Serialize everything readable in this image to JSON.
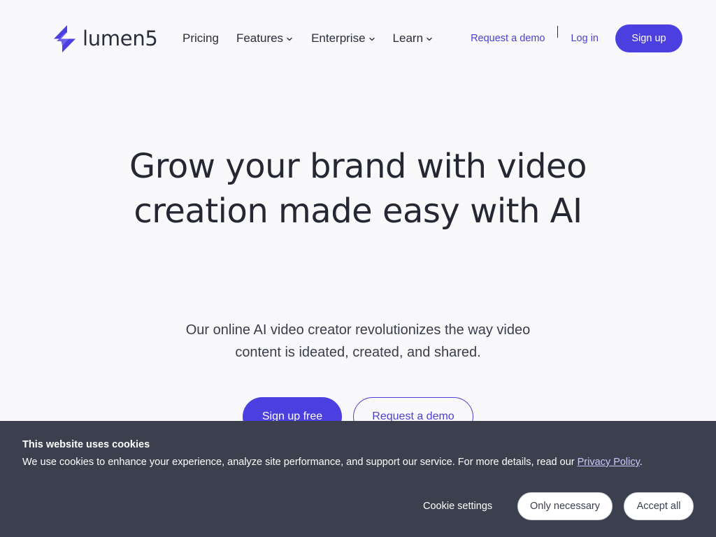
{
  "brand": {
    "name": "lumen5",
    "accent_color": "#4b3fe0"
  },
  "nav": {
    "items": [
      {
        "label": "Pricing",
        "has_dropdown": false
      },
      {
        "label": "Features",
        "has_dropdown": true
      },
      {
        "label": "Enterprise",
        "has_dropdown": true
      },
      {
        "label": "Learn",
        "has_dropdown": true
      }
    ]
  },
  "header_actions": {
    "request_demo": "Request a demo",
    "login": "Log in",
    "signup": "Sign up"
  },
  "hero": {
    "title": "Grow your brand with video creation made easy with AI",
    "subtitle": "Our online AI video creator revolutionizes the way video content is ideated, created, and shared.",
    "primary_cta": "Sign up free",
    "secondary_cta": "Request a demo"
  },
  "cookie_banner": {
    "title": "This website uses cookies",
    "text": "We use cookies to enhance your experience, analyze site performance, and support our service. For more details, read our ",
    "link_text": "Privacy Policy",
    "text_end": ".",
    "settings": "Cookie settings",
    "only_necessary": "Only necessary",
    "accept_all": "Accept all",
    "background_color": "#3c3f4d"
  },
  "icons": {
    "logo": "lumen5-bolt-logo-icon",
    "dropdown": "chevron-down-icon"
  }
}
